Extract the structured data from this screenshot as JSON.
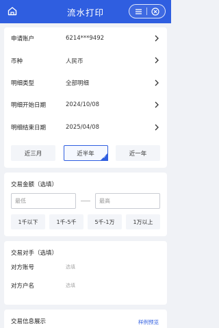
{
  "header": {
    "title": "流水打印",
    "home_icon": "home-icon",
    "menu_icon": "menu-icon",
    "close_icon": "close-circle-icon"
  },
  "detail_rows": [
    {
      "label": "申请账户",
      "value": "6214***9492"
    },
    {
      "label": "币种",
      "value": "人民币"
    },
    {
      "label": "明细类型",
      "value": "全部明细"
    },
    {
      "label": "明细开始日期",
      "value": "2024/10/08"
    },
    {
      "label": "明细结束日期",
      "value": "2025/04/08"
    }
  ],
  "periods": {
    "items": [
      "近三月",
      "近半年",
      "近一年"
    ],
    "selected": "近半年"
  },
  "amount": {
    "title": "交易金额（选填）",
    "min_placeholder": "最低",
    "max_placeholder": "最高",
    "ranges": [
      "1千以下",
      "1千-5千",
      "5千-1万",
      "1万以上"
    ]
  },
  "counterparty": {
    "title": "交易对手（选填）",
    "account_label": "对方账号",
    "account_placeholder": "选填",
    "name_label": "对方户名",
    "name_placeholder": "选填"
  },
  "display": {
    "title": "交易信息展示",
    "link": "样例预览"
  },
  "colors": {
    "brand": "#2f5ee0",
    "page_bg": "#f0f2f6"
  }
}
